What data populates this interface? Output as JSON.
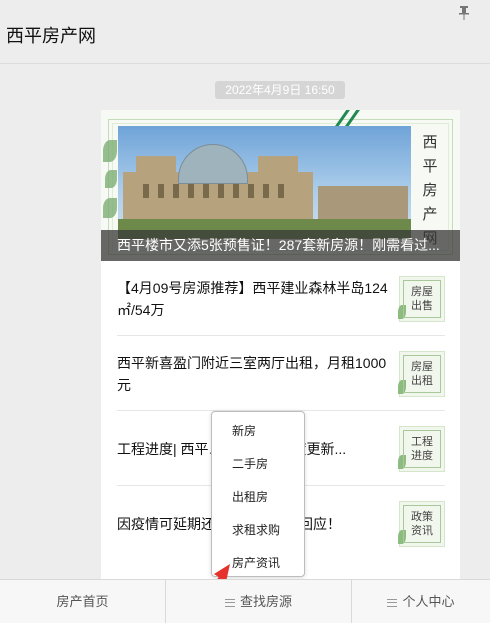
{
  "window": {
    "title": "西平房产网"
  },
  "chat": {
    "timestamp": "2022年4月9日 16:50"
  },
  "article": {
    "side_title": "西平房产网",
    "hero_caption": "西平楼市又添5张预售证！287套新房源！刚需看过...",
    "items": [
      {
        "text": "【4月09号房源推荐】西平建业森林半岛124㎡/54万",
        "thumb": "房屋出售"
      },
      {
        "text": "西平新喜盈门附近三室两厅出租，月租1000元",
        "thumb": "房屋出租"
      },
      {
        "text": "工程进度| 西平……………进度更新...",
        "thumb": "工程进度"
      },
      {
        "text": "因疫情可延期还……………厅回应！",
        "thumb": "政策资讯"
      }
    ]
  },
  "popup_menu": {
    "items": [
      "新房",
      "二手房",
      "出租房",
      "求租求购",
      "房产资讯"
    ]
  },
  "tabbar": {
    "tabs": [
      "房产首页",
      "查找房源",
      "个人中心"
    ]
  },
  "colors": {
    "accent_arrow": "#e5322d",
    "thumb_green": "#8cbc80"
  }
}
